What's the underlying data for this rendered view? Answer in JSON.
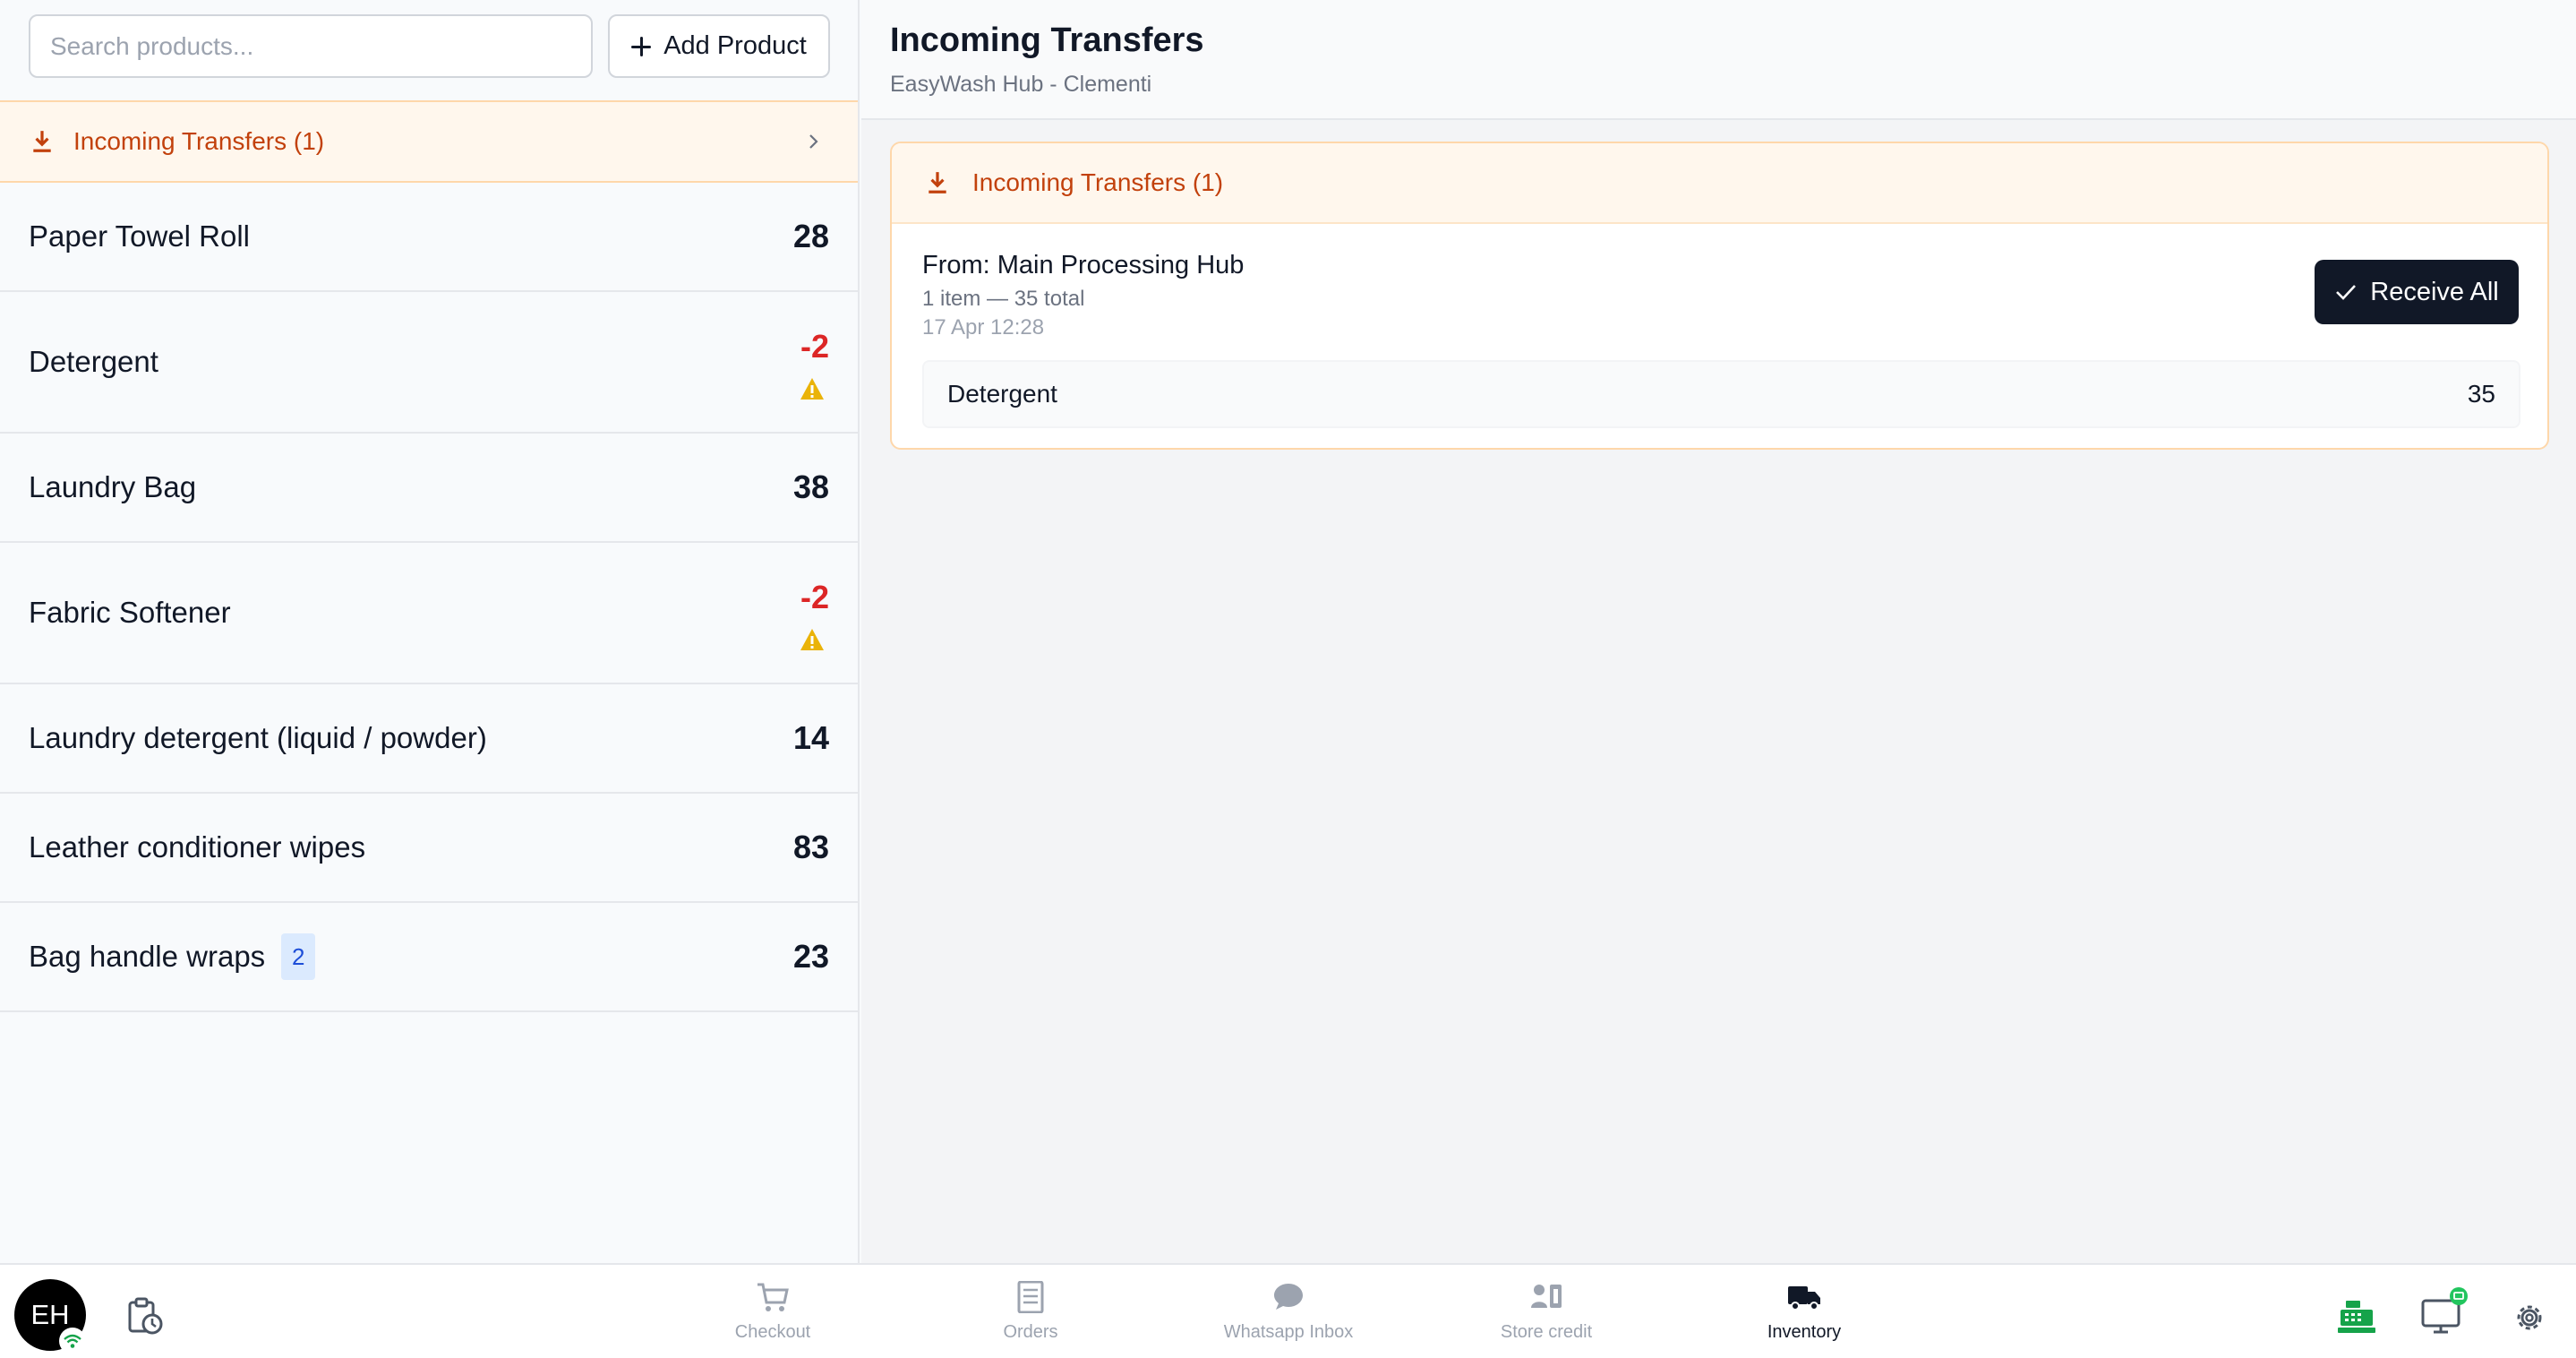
{
  "search": {
    "placeholder": "Search products..."
  },
  "toolbar": {
    "add_product_label": "Add Product"
  },
  "transfers_banner": {
    "label": "Incoming Transfers (1)"
  },
  "products": [
    {
      "name": "Paper Towel Roll",
      "qty": "28"
    },
    {
      "name": "Detergent",
      "qty": "-2",
      "warning": true
    },
    {
      "name": "Laundry Bag",
      "qty": "38"
    },
    {
      "name": "Fabric Softener",
      "qty": "-2",
      "warning": true
    },
    {
      "name": "Laundry detergent (liquid / powder)",
      "qty": "14"
    },
    {
      "name": "Leather conditioner wipes",
      "qty": "83"
    },
    {
      "name": "Bag handle wraps",
      "qty": "23",
      "badge": "2"
    }
  ],
  "header": {
    "title": "Incoming Transfers",
    "subtitle": "EasyWash Hub - Clementi"
  },
  "transfer_card": {
    "title": "Incoming Transfers (1)",
    "from": "From: Main Processing Hub",
    "summary": "1 item — 35 total",
    "time": "17 Apr 12:28",
    "receive_all_label": "Receive All",
    "items": [
      {
        "name": "Detergent",
        "qty": "35"
      }
    ]
  },
  "user": {
    "initials": "EH"
  },
  "nav": [
    {
      "label": "Checkout",
      "icon": "cart-icon",
      "active": false
    },
    {
      "label": "Orders",
      "icon": "receipt-icon",
      "active": false
    },
    {
      "label": "Whatsapp Inbox",
      "icon": "chat-bubble-icon",
      "active": false
    },
    {
      "label": "Store credit",
      "icon": "wallet-icon",
      "active": false
    },
    {
      "label": "Inventory",
      "icon": "truck-icon",
      "active": true
    }
  ],
  "colors": {
    "accent_orange": "#c2410c",
    "banner_bg": "#fff7ed",
    "negative": "#dc2626",
    "warning": "#eab308",
    "primary_button": "#111827",
    "online_green": "#16a34a"
  }
}
